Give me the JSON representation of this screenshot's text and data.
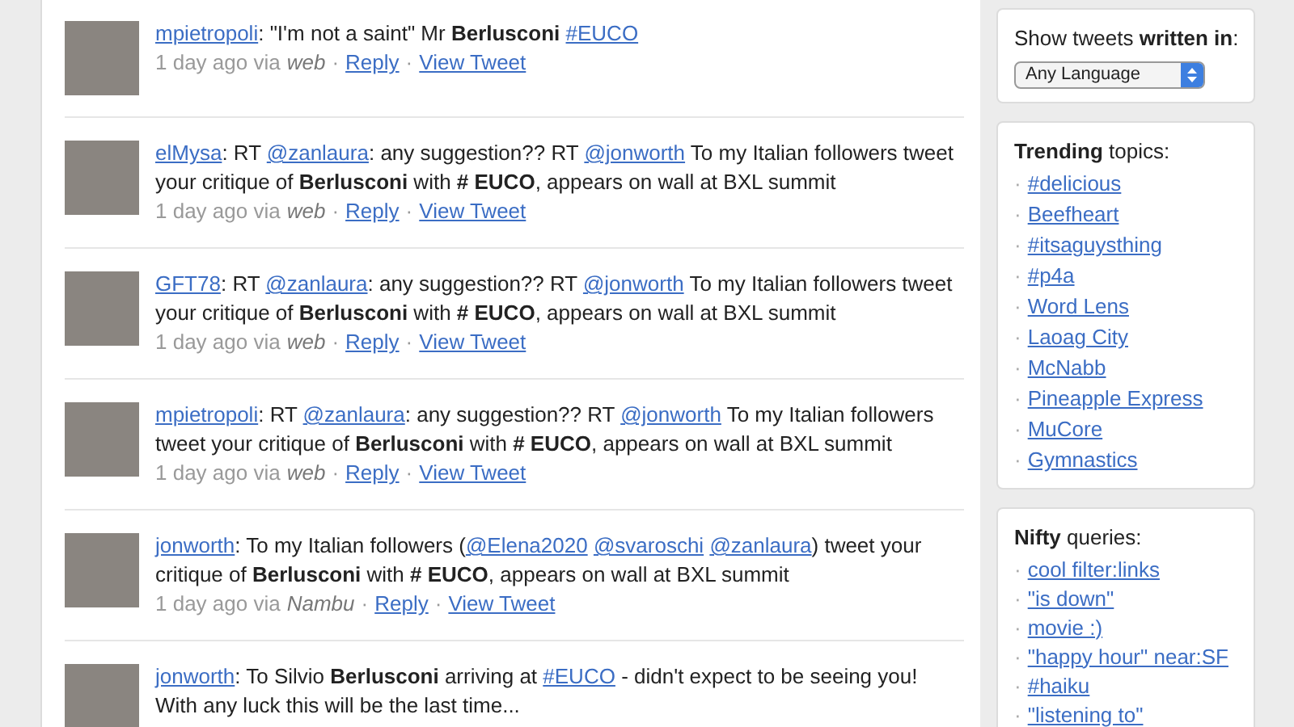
{
  "tweets": [
    {
      "user": "mpietropoli",
      "segments": [
        {
          "kind": "text",
          "text": ": \"I'm not a saint\" Mr "
        },
        {
          "kind": "bold",
          "text": "Berlusconi"
        },
        {
          "kind": "space"
        },
        {
          "kind": "link",
          "text": "#EUCO"
        }
      ],
      "time": "1 day ago via",
      "source": "web",
      "actions": [
        {
          "sep": "·",
          "label": "Reply"
        },
        {
          "sep": "·",
          "label": "View Tweet"
        }
      ]
    },
    {
      "user": "elMysa",
      "segments": [
        {
          "kind": "text",
          "text": ": RT "
        },
        {
          "kind": "link",
          "text": "@zanlaura"
        },
        {
          "kind": "text",
          "text": ": any suggestion?? RT "
        },
        {
          "kind": "link",
          "text": "@jonworth"
        },
        {
          "kind": "text",
          "text": " To my Italian followers tweet your critique of "
        },
        {
          "kind": "bold",
          "text": "Berlusconi"
        },
        {
          "kind": "text",
          "text": " with "
        },
        {
          "kind": "bold",
          "text": "# EUCO"
        },
        {
          "kind": "text",
          "text": ", appears on wall at BXL summit"
        }
      ],
      "time": "1 day ago via",
      "source": "web",
      "actions": [
        {
          "sep": "·",
          "label": "Reply"
        },
        {
          "sep": "·",
          "label": "View Tweet"
        }
      ]
    },
    {
      "user": "GFT78",
      "segments": [
        {
          "kind": "text",
          "text": ": RT "
        },
        {
          "kind": "link",
          "text": "@zanlaura"
        },
        {
          "kind": "text",
          "text": ": any suggestion?? RT "
        },
        {
          "kind": "link",
          "text": "@jonworth"
        },
        {
          "kind": "text",
          "text": " To my Italian followers tweet your critique of "
        },
        {
          "kind": "bold",
          "text": "Berlusconi"
        },
        {
          "kind": "text",
          "text": " with "
        },
        {
          "kind": "bold",
          "text": "# EUCO"
        },
        {
          "kind": "text",
          "text": ", appears on wall at BXL summit"
        }
      ],
      "time": "1 day ago via",
      "source": "web",
      "actions": [
        {
          "sep": "·",
          "label": "Reply"
        },
        {
          "sep": "·",
          "label": "View Tweet"
        }
      ]
    },
    {
      "user": "mpietropoli",
      "segments": [
        {
          "kind": "text",
          "text": ": RT "
        },
        {
          "kind": "link",
          "text": "@zanlaura"
        },
        {
          "kind": "text",
          "text": ": any suggestion?? RT "
        },
        {
          "kind": "link",
          "text": "@jonworth"
        },
        {
          "kind": "text",
          "text": " To my Italian followers tweet your critique of "
        },
        {
          "kind": "bold",
          "text": "Berlusconi"
        },
        {
          "kind": "text",
          "text": " with "
        },
        {
          "kind": "bold",
          "text": "# EUCO"
        },
        {
          "kind": "text",
          "text": ", appears on wall at BXL summit"
        }
      ],
      "time": "1 day ago via",
      "source": "web",
      "actions": [
        {
          "sep": "·",
          "label": "Reply"
        },
        {
          "sep": "·",
          "label": "View Tweet"
        }
      ]
    },
    {
      "user": "jonworth",
      "segments": [
        {
          "kind": "text",
          "text": ": To my Italian followers ("
        },
        {
          "kind": "link",
          "text": "@Elena2020"
        },
        {
          "kind": "space"
        },
        {
          "kind": "link",
          "text": "@svaroschi"
        },
        {
          "kind": "space"
        },
        {
          "kind": "link",
          "text": "@zanlaura"
        },
        {
          "kind": "text",
          "text": ") tweet your critique of "
        },
        {
          "kind": "bold",
          "text": "Berlusconi"
        },
        {
          "kind": "text",
          "text": " with "
        },
        {
          "kind": "bold",
          "text": "# EUCO"
        },
        {
          "kind": "text",
          "text": ", appears on wall at BXL summit"
        }
      ],
      "time": "1 day ago via",
      "source": "Nambu",
      "actions": [
        {
          "sep": "·",
          "label": "Reply"
        },
        {
          "sep": "·",
          "label": "View Tweet"
        }
      ]
    },
    {
      "user": "jonworth",
      "segments": [
        {
          "kind": "text",
          "text": ": To Silvio "
        },
        {
          "kind": "bold",
          "text": "Berlusconi"
        },
        {
          "kind": "text",
          "text": " arriving at "
        },
        {
          "kind": "link",
          "text": "#EUCO"
        },
        {
          "kind": "text",
          "text": " - didn't expect to be seeing you! With any luck this will be the last time..."
        }
      ]
    }
  ],
  "language_box": {
    "label_start": "Show tweets ",
    "label_bold": "written in",
    "label_end": ":",
    "select": "Any Language"
  },
  "trending": {
    "title_bold": "Trending",
    "title_rest": " topics:",
    "items": [
      {
        "bullet": "·",
        "label": "#delicious"
      },
      {
        "bullet": "·",
        "label": "Beefheart"
      },
      {
        "bullet": "·",
        "label": "#itsaguysthing"
      },
      {
        "bullet": "·",
        "label": "#p4a"
      },
      {
        "bullet": "·",
        "label": "Word Lens"
      },
      {
        "bullet": "·",
        "label": "Laoag City"
      },
      {
        "bullet": "·",
        "label": "McNabb"
      },
      {
        "bullet": "·",
        "label": "Pineapple Express"
      },
      {
        "bullet": "·",
        "label": "MuCore"
      },
      {
        "bullet": "·",
        "label": "Gymnastics"
      }
    ]
  },
  "nifty": {
    "title_bold": "Nifty",
    "title_rest": " queries:",
    "items": [
      {
        "bullet": "·",
        "label": "cool filter:links"
      },
      {
        "bullet": "·",
        "label": "\"is down\""
      },
      {
        "bullet": "·",
        "label": "movie :)"
      },
      {
        "bullet": "·",
        "label": "\"happy hour\" near:SF"
      },
      {
        "bullet": "·",
        "label": "#haiku"
      },
      {
        "bullet": "·",
        "label": "\"listening to\""
      }
    ]
  }
}
